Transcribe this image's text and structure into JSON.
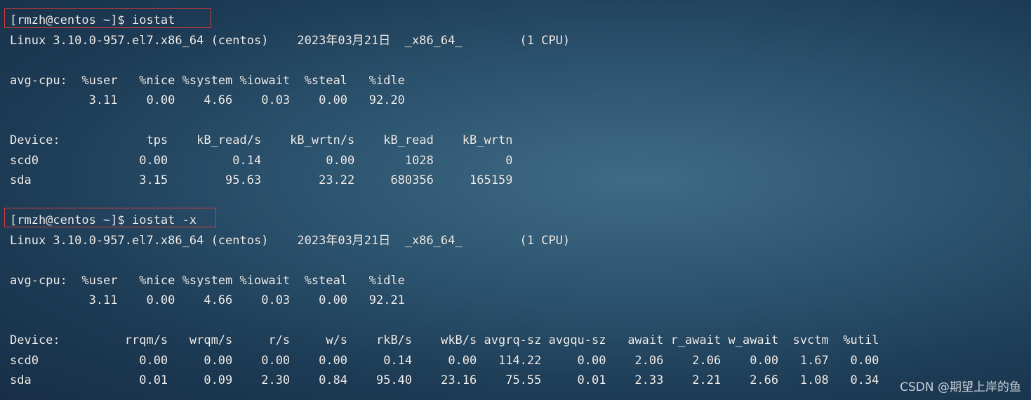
{
  "terminal": {
    "block1": {
      "prompt": "[rmzh@centos ~]$ iostat",
      "sysinfo": "Linux 3.10.0-957.el7.x86_64 (centos)    2023年03月21日  _x86_64_        (1 CPU)",
      "cpu_header": "avg-cpu:  %user   %nice %system %iowait  %steal   %idle",
      "cpu_values": "           3.11    0.00    4.66    0.03    0.00   92.20",
      "dev_header": "Device:            tps    kB_read/s    kB_wrtn/s    kB_read    kB_wrtn",
      "rows": [
        "scd0              0.00         0.14         0.00       1028          0",
        "sda               3.15        95.63        23.22     680356     165159"
      ]
    },
    "block2": {
      "prompt": "[rmzh@centos ~]$ iostat -x",
      "sysinfo": "Linux 3.10.0-957.el7.x86_64 (centos)    2023年03月21日  _x86_64_        (1 CPU)",
      "cpu_header": "avg-cpu:  %user   %nice %system %iowait  %steal   %idle",
      "cpu_values": "           3.11    0.00    4.66    0.03    0.00   92.21",
      "dev_header": "Device:         rrqm/s   wrqm/s     r/s     w/s    rkB/s    wkB/s avgrq-sz avgqu-sz   await r_await w_await  svctm  %util",
      "rows": [
        "scd0              0.00     0.00    0.00    0.00     0.14     0.00   114.22     0.00    2.06    2.06    0.00   1.67   0.00",
        "sda               0.01     0.09    2.30    0.84    95.40    23.16    75.55     0.01    2.33    2.21    2.66   1.08   0.34"
      ]
    }
  },
  "watermark": "CSDN @期望上岸的鱼",
  "colors": {
    "highlight": "#d23a3a",
    "text": "#f0f0f0"
  }
}
